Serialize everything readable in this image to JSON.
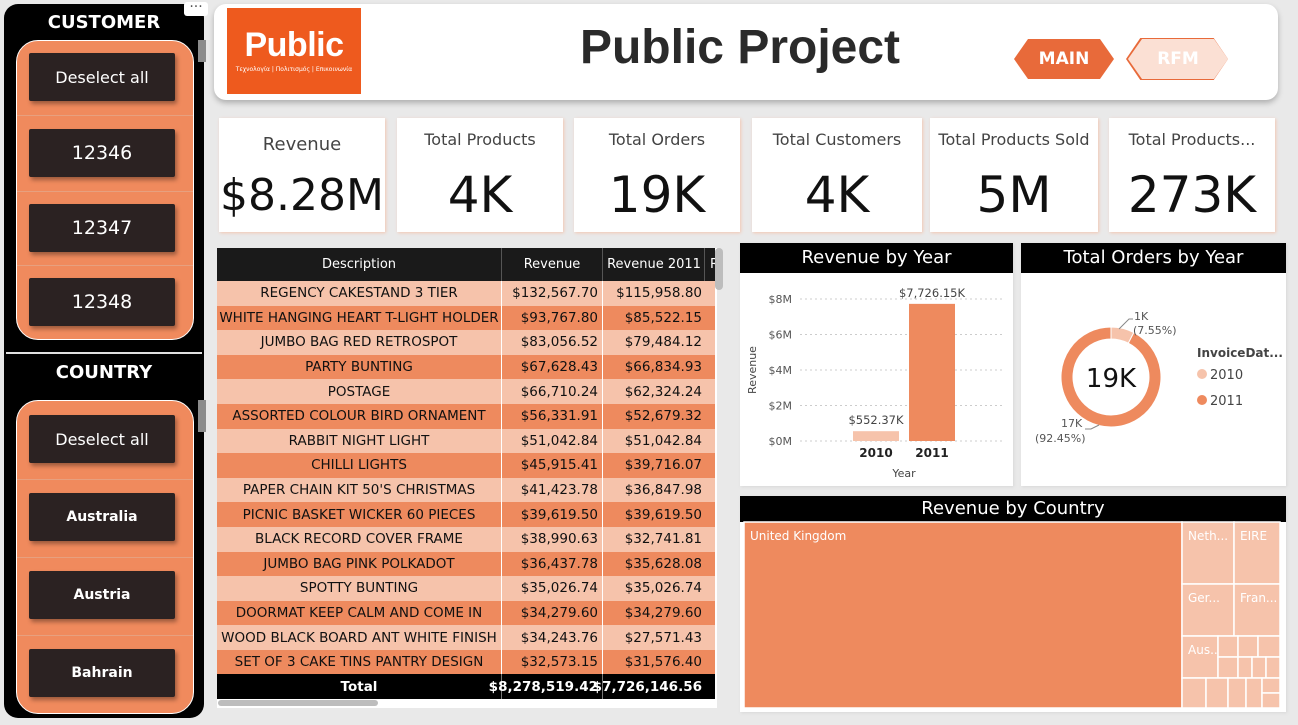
{
  "slicers": {
    "customer": {
      "title": "CUSTOMER",
      "items": [
        "Deselect all",
        "12346",
        "12347",
        "12348"
      ]
    },
    "country": {
      "title": "COUNTRY",
      "items": [
        "Deselect all",
        "Australia",
        "Austria",
        "Bahrain"
      ]
    }
  },
  "header": {
    "title": "Public Project",
    "logo_text": "Public",
    "logo_tagline": "Τεχνολογία | Πολιτισμός | Επικοινωνία",
    "tabs": [
      {
        "label": "MAIN"
      },
      {
        "label": "RFM"
      }
    ]
  },
  "kpis": [
    {
      "label": "Revenue",
      "value": "$8.28M"
    },
    {
      "label": "Total Products",
      "value": "4K"
    },
    {
      "label": "Total Orders",
      "value": "19K"
    },
    {
      "label": "Total Customers",
      "value": "4K"
    },
    {
      "label": "Total Products Sold",
      "value": "5M"
    },
    {
      "label": "Total Products...",
      "value": "273K"
    }
  ],
  "table": {
    "columns": [
      "Description",
      "Revenue",
      "Revenue 2011",
      "R"
    ],
    "rows": [
      {
        "desc": "REGENCY CAKESTAND 3 TIER",
        "rev": "$132,567.70",
        "rev2011": "$115,958.80"
      },
      {
        "desc": "WHITE HANGING HEART T-LIGHT HOLDER",
        "rev": "$93,767.80",
        "rev2011": "$85,522.15"
      },
      {
        "desc": "JUMBO BAG RED RETROSPOT",
        "rev": "$83,056.52",
        "rev2011": "$79,484.12"
      },
      {
        "desc": "PARTY BUNTING",
        "rev": "$67,628.43",
        "rev2011": "$66,834.93"
      },
      {
        "desc": "POSTAGE",
        "rev": "$66,710.24",
        "rev2011": "$62,324.24"
      },
      {
        "desc": "ASSORTED COLOUR BIRD ORNAMENT",
        "rev": "$56,331.91",
        "rev2011": "$52,679.32"
      },
      {
        "desc": "RABBIT NIGHT LIGHT",
        "rev": "$51,042.84",
        "rev2011": "$51,042.84"
      },
      {
        "desc": "CHILLI LIGHTS",
        "rev": "$45,915.41",
        "rev2011": "$39,716.07"
      },
      {
        "desc": "PAPER CHAIN KIT 50'S CHRISTMAS",
        "rev": "$41,423.78",
        "rev2011": "$36,847.98"
      },
      {
        "desc": "PICNIC BASKET WICKER 60 PIECES",
        "rev": "$39,619.50",
        "rev2011": "$39,619.50"
      },
      {
        "desc": "BLACK RECORD COVER FRAME",
        "rev": "$38,990.63",
        "rev2011": "$32,741.81"
      },
      {
        "desc": "JUMBO BAG PINK POLKADOT",
        "rev": "$36,437.78",
        "rev2011": "$35,628.08"
      },
      {
        "desc": "SPOTTY BUNTING",
        "rev": "$35,026.74",
        "rev2011": "$35,026.74"
      },
      {
        "desc": "DOORMAT KEEP CALM AND COME IN",
        "rev": "$34,279.60",
        "rev2011": "$34,279.60"
      },
      {
        "desc": "WOOD BLACK BOARD ANT WHITE FINISH",
        "rev": "$34,243.76",
        "rev2011": "$27,571.43"
      },
      {
        "desc": "SET OF 3 CAKE TINS PANTRY DESIGN",
        "rev": "$32,573.15",
        "rev2011": "$31,576.40"
      }
    ],
    "total": {
      "label": "Total",
      "rev": "$8,278,519.42",
      "rev2011": "$7,726,146.56"
    }
  },
  "colors": {
    "accent": "#ee8a5e",
    "accent_light": "#f6c3ab",
    "brand": "#ee5a1e",
    "dark": "#1a1a1a"
  },
  "chart_data": [
    {
      "type": "bar",
      "title": "Revenue by Year",
      "categories": [
        "2010",
        "2011"
      ],
      "values": [
        552.37,
        7726.15
      ],
      "data_labels": [
        "$552.37K",
        "$7,726.15K"
      ],
      "xlabel": "Year",
      "ylabel": "Revenue",
      "yticks": [
        "$0M",
        "$2M",
        "$4M",
        "$6M",
        "$8M"
      ],
      "ylim": [
        0,
        8000
      ],
      "grid": true
    },
    {
      "type": "pie",
      "title": "Total Orders by Year",
      "center_label": "19K",
      "legend_title": "InvoiceDat...",
      "legend_position": "right",
      "slices": [
        {
          "name": "2010",
          "value": 7.55,
          "label": "1K",
          "pct_label": "(7.55%)"
        },
        {
          "name": "2011",
          "value": 92.45,
          "label": "17K",
          "pct_label": "(92.45%)"
        }
      ]
    },
    {
      "type": "treemap",
      "title": "Revenue by Country",
      "nodes": [
        {
          "name": "United Kingdom",
          "label": "United Kingdom"
        },
        {
          "name": "Netherlands",
          "label": "Neth..."
        },
        {
          "name": "EIRE",
          "label": "EIRE"
        },
        {
          "name": "Germany",
          "label": "Ger..."
        },
        {
          "name": "France",
          "label": "Fran..."
        },
        {
          "name": "Australia",
          "label": "Aus..."
        }
      ]
    }
  ]
}
